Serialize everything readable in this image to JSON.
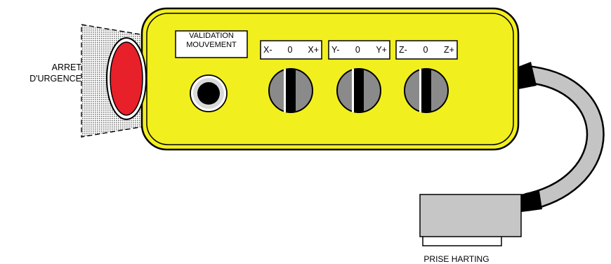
{
  "labels": {
    "emergency_stop_line1": "ARRET",
    "emergency_stop_line2": "D'URGENCE",
    "validation_line1": "VALIDATION",
    "validation_line2": "MOUVEMENT",
    "connector": "PRISE HARTING"
  },
  "axes": [
    {
      "minus": "X-",
      "zero": "0",
      "plus": "X+"
    },
    {
      "minus": "Y-",
      "zero": "0",
      "plus": "Y+"
    },
    {
      "minus": "Z-",
      "zero": "0",
      "plus": "Z+"
    }
  ],
  "colors": {
    "pendant_body": "#f2ef1e",
    "emergency_button": "#e8202a",
    "selector_knob": "#8a8a8a",
    "cable": "#c4c4c4",
    "connector": "#c6c6c6"
  }
}
